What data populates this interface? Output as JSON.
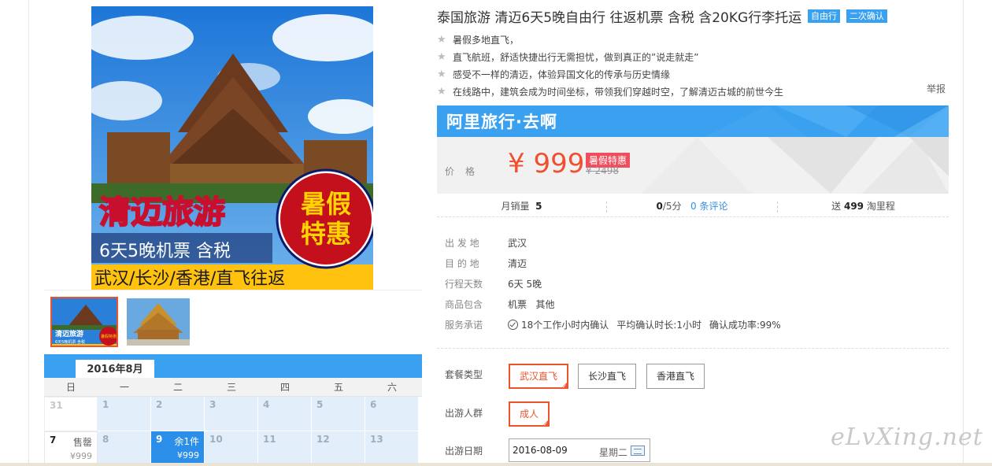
{
  "product": {
    "title": "泰国旅游 清迈6天5晚自由行 往返机票 含税 含20KG行李托运",
    "tags": [
      "自由行",
      "二次确认"
    ],
    "features": [
      "暑假多地直飞，",
      "直飞航班，舒适快捷出行无需担忧，做到真正的”说走就走”",
      "感受不一样的清迈，体验异国文化的传承与历史情缘",
      "在线路中，建筑会成为时间坐标，带领我们穿越时空，了解清迈古城的前世今生"
    ],
    "report_label": "举报"
  },
  "hero_image": {
    "headline": "清迈旅游",
    "subline": "6天5晚机票 含税",
    "routes": "武汉/长沙/香港/直飞往返",
    "badge_line1": "暑假",
    "badge_line2": "特惠"
  },
  "thumbnail_text": {
    "headline": "清迈旅游",
    "subline": "6天5晚机票 含税",
    "badge": "暑假特惠"
  },
  "banner": {
    "brand": "阿里旅行·去啊"
  },
  "price": {
    "label": "价格",
    "value": "¥ 999",
    "promo_tag": "暑假特惠",
    "old_price": "¥ 2498"
  },
  "stats": {
    "monthly_sales_label": "月销量",
    "monthly_sales_value": "5",
    "rating_value": "0",
    "rating_suffix": "/5分",
    "reviews_link": "0 条评论",
    "mileage_prefix": "送",
    "mileage_value": "499",
    "mileage_suffix": "淘里程"
  },
  "info": {
    "rows": [
      {
        "key": "出 发 地",
        "value": "武汉"
      },
      {
        "key": "目 的 地",
        "value": "清迈"
      },
      {
        "key": "行程天数",
        "value": "6天 5晚"
      },
      {
        "key": "商品包含",
        "value": "机票   其他"
      }
    ],
    "promise_key": "服务承诺",
    "promise_items": [
      "18个工作小时内确认",
      "平均确认时长:1小时",
      "确认成功率:99%"
    ]
  },
  "options": {
    "package_label": "套餐类型",
    "packages": [
      "武汉直飞",
      "长沙直飞",
      "香港直飞"
    ],
    "selected_package": "武汉直飞",
    "group_label": "出游人群",
    "groups": [
      "成人"
    ],
    "date_label": "出游日期",
    "date_value": "2016-08-09",
    "date_weekday": "星期二"
  },
  "calendar": {
    "month": "2016年8月",
    "weekdays": [
      "日",
      "一",
      "二",
      "三",
      "四",
      "五",
      "六"
    ],
    "row1": [
      "31",
      "1",
      "2",
      "3",
      "4",
      "5",
      "6"
    ],
    "row2": [
      {
        "day": "7",
        "status": "售罄",
        "price": "¥999"
      },
      {
        "day": "8",
        "status": "",
        "price": ""
      },
      {
        "day": "9",
        "status": "余1件",
        "price": "¥999"
      },
      {
        "day": "10",
        "status": "",
        "price": ""
      },
      {
        "day": "11",
        "status": "",
        "price": ""
      },
      {
        "day": "12",
        "status": "",
        "price": ""
      },
      {
        "day": "13",
        "status": "",
        "price": ""
      }
    ]
  },
  "watermark": "eLvXing.net",
  "colors": {
    "accent_blue": "#3aa0f0",
    "price_red": "#f0502f",
    "select_orange": "#e9562e"
  }
}
